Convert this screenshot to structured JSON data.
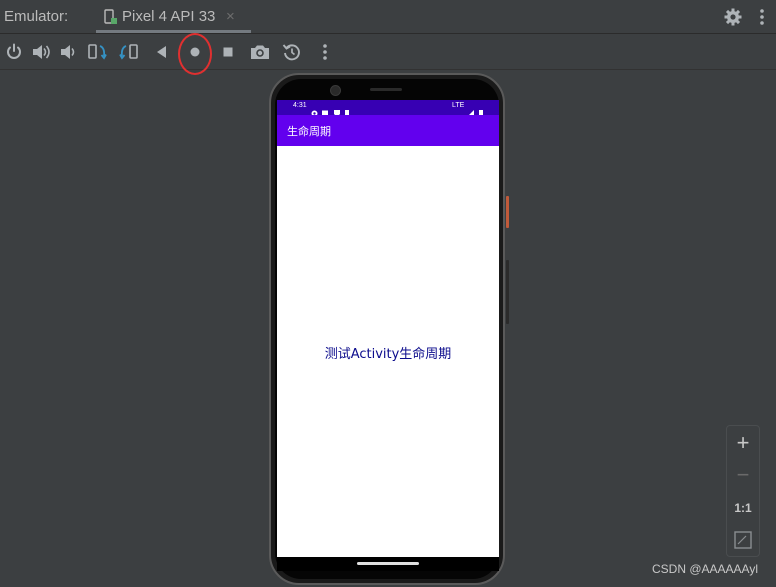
{
  "titlebar": {
    "app_title": "Emulator:",
    "tab_label": "Pixel 4 API 33",
    "tab_close": "×",
    "tab_icon": "device-phone-icon",
    "settings_icon": "gear-icon",
    "more_icon": "vertical-dots-icon"
  },
  "toolbar": {
    "items": [
      {
        "name": "power-button",
        "icon": "power-icon"
      },
      {
        "name": "volume-up-button",
        "icon": "volume-up-icon"
      },
      {
        "name": "volume-down-button",
        "icon": "volume-down-icon"
      },
      {
        "name": "rotate-left-button",
        "icon": "rotate-left-icon"
      },
      {
        "name": "rotate-right-button",
        "icon": "rotate-right-icon"
      },
      {
        "name": "back-button",
        "icon": "back-triangle-icon"
      },
      {
        "name": "home-button",
        "icon": "home-circle-icon"
      },
      {
        "name": "overview-button",
        "icon": "overview-square-icon"
      },
      {
        "name": "screenshot-button",
        "icon": "camera-icon"
      },
      {
        "name": "snapshot-button",
        "icon": "snapshot-restore-icon"
      },
      {
        "name": "extended-controls-button",
        "icon": "vertical-dots-icon"
      }
    ],
    "annotation_color": "#e03030"
  },
  "device": {
    "status_time": "4:31",
    "status_network": "LTE",
    "app_title": "生命周期",
    "center_text": "测试Activity生命周期",
    "colors": {
      "status_bar": "#3700b3",
      "app_bar": "#6200ee",
      "center_text": "#0b0b8c"
    }
  },
  "zoom": {
    "zoom_in": "+",
    "zoom_out": "−",
    "actual_size": "1:1",
    "fit_icon": "fit-screen-icon"
  },
  "watermark": "CSDN @AAAAAAyl"
}
